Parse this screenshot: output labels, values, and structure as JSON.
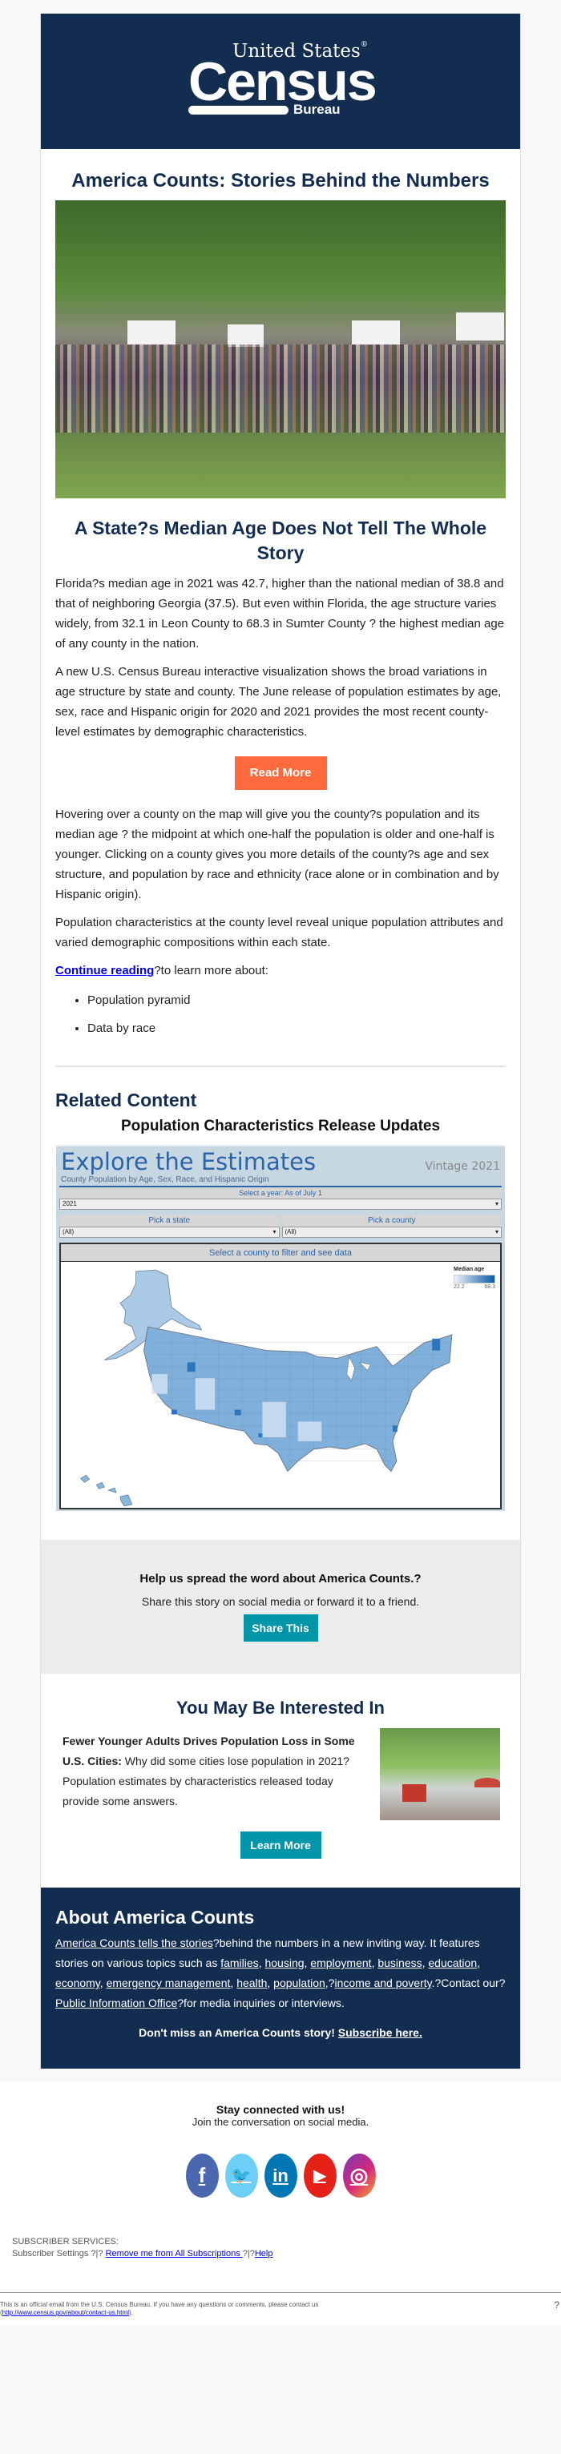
{
  "header": {
    "logo_line1": "United States",
    "logo_reg": "®",
    "logo_main": "Census",
    "logo_sub": "Bureau"
  },
  "page_title": "America Counts: Stories Behind the Numbers",
  "hero_image_alt": "Crowd of people sitting on grass at an outdoor festival",
  "article": {
    "title": "A State?s Median Age Does Not Tell The Whole Story",
    "para1": "Florida?s median age in 2021 was 42.7, higher than the national median of 38.8 and that of neighboring Georgia (37.5). But even within Florida, the age structure varies widely, from 32.1 in Leon County to 68.3 in Sumter County ? the highest median age of any county in the nation.",
    "para2": "A new U.S. Census Bureau interactive visualization shows the broad variations in age structure by state and county. The June release of population estimates by age, sex, race and Hispanic origin for 2020 and 2021 provides the most recent county-level estimates by demographic characteristics.",
    "read_more": "Read More",
    "para3": "Hovering over a county on the map will give you the county?s population and its median age ? the midpoint at which one-half the population is older and one-half is younger. Clicking on a county gives you more details of the county?s age and sex structure, and population by race and ethnicity (race alone or in combination and by Hispanic origin).",
    "para4": "Population characteristics at the county level reveal unique population attributes and varied demographic compositions within each state.",
    "continue_link": "Continue reading",
    "continue_rest": "?to learn more about:",
    "bullets": [
      "Population pyramid",
      "Data by race"
    ]
  },
  "related": {
    "heading": "Related Content",
    "subheading": "Population Characteristics Release Updates",
    "viz": {
      "title": "Explore the Estimates",
      "vintage": "Vintage 2021",
      "subtitle": "County Population by Age, Sex, Race, and Hispanic Origin",
      "year_label": "Select a year: As of July 1",
      "year_value": "2021",
      "state_label": "Pick a state",
      "state_value": "(All)",
      "county_label": "Pick a county",
      "county_value": "(All)",
      "map_title": "Select a county to filter and see data",
      "legend_title": "Median age",
      "legend_min": "22.2",
      "legend_max": "68.3",
      "dropdown_glyph": "▾"
    }
  },
  "share": {
    "heading": "Help us spread the word about America Counts.?",
    "text": "Share this story on social media or forward it to a friend.",
    "button": "Share This"
  },
  "interest": {
    "heading": "You May Be Interested In",
    "bold": "Fewer Younger Adults Drives Population Loss in Some U.S. Cities:",
    "text": " Why did some cities lose population in 2021? Population estimates by characteristics released today provide some answers.",
    "button": "Learn More"
  },
  "about": {
    "heading": "About America Counts",
    "link1": "America Counts tells the stories",
    "t1": "?behind the numbers in a new inviting way. It features stories on various topics such as ",
    "topics": [
      "families",
      "housing",
      "employment",
      "business",
      "education",
      "economy",
      "emergency management",
      "health",
      "population",
      "income and poverty"
    ],
    "t2": ".?Contact our?",
    "pio": "Public Information Office",
    "t3": "?for media inquiries or interviews.",
    "cta": "Don't miss an America Counts story! ",
    "cta_link": "Subscribe here."
  },
  "social": {
    "heading": "Stay connected with us!",
    "text": "Join the conversation on social media.",
    "icons": [
      {
        "name": "facebook",
        "glyph": "f",
        "color": "#4a67b0"
      },
      {
        "name": "twitter",
        "glyph": "🐦",
        "color": "#6dcff6"
      },
      {
        "name": "linkedin",
        "glyph": "in",
        "color": "#0077b5"
      },
      {
        "name": "youtube",
        "glyph": "▶",
        "color": "#e62117"
      },
      {
        "name": "instagram",
        "glyph": "◎",
        "color": "#c1358f"
      }
    ]
  },
  "subscriber": {
    "label": "SUBSCRIBER SERVICES:",
    "settings": "Subscriber Settings ?|? ",
    "remove": "Remove me from All Subscriptions ",
    "sep": "?|?",
    "help": "Help"
  },
  "footer": {
    "text": "This is an official email from the U.S. Census Bureau. If you have any questions or comments, please contact us",
    "link": "http://www.census.gov/about/contact-us.html",
    "end": ").",
    "start": "(",
    "mark": "?"
  }
}
